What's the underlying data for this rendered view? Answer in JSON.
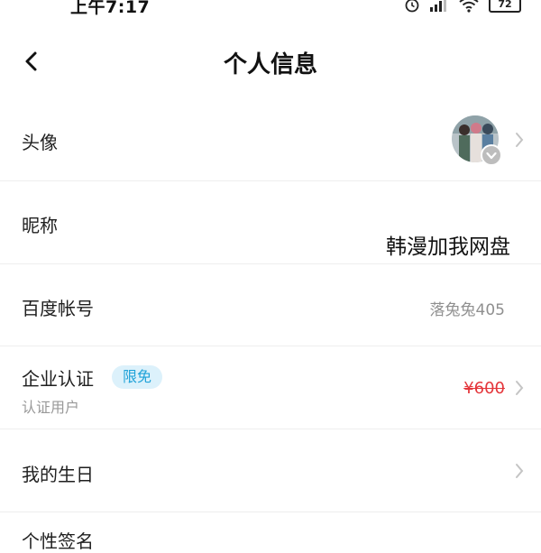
{
  "status_bar": {
    "time": "上午7:17",
    "battery": "72"
  },
  "header": {
    "title": "个人信息"
  },
  "rows": {
    "avatar": {
      "label": "头像"
    },
    "nickname": {
      "label": "昵称"
    },
    "account": {
      "label": "百度帐号",
      "value": "落兔兔405"
    },
    "enterprise": {
      "label": "企业认证",
      "badge": "限免",
      "sublabel": "认证用户",
      "price": "¥600"
    },
    "birthday": {
      "label": "我的生日"
    },
    "signature": {
      "label": "个性签名"
    }
  },
  "overlay": {
    "text": "韩漫加我网盘"
  },
  "colors": {
    "accent_badge_bg": "#dcf1fb",
    "accent_badge_text": "#1fa2d8",
    "price_red": "#e4363b",
    "divider": "#eeeeee"
  }
}
